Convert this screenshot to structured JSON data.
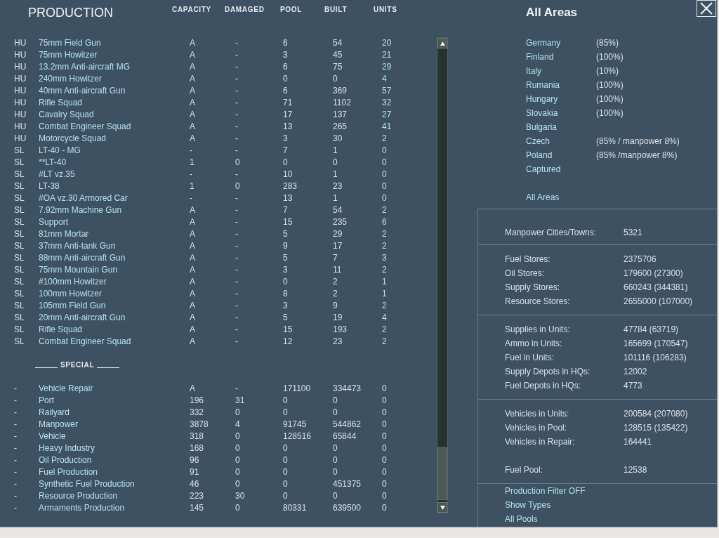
{
  "production": {
    "title": "PRODUCTION",
    "columns": [
      "CAPACITY",
      "DAMAGED",
      "POOL",
      "BUILT",
      "UNITS"
    ],
    "rows": [
      {
        "nation": "HU",
        "name": "75mm Field Gun",
        "capacity": "A",
        "damaged": "-",
        "pool": "6",
        "built": "54",
        "units": "20"
      },
      {
        "nation": "HU",
        "name": "75mm Howitzer",
        "capacity": "A",
        "damaged": "-",
        "pool": "3",
        "built": "45",
        "units": "21"
      },
      {
        "nation": "HU",
        "name": "13.2mm Anti-aircraft MG",
        "capacity": "A",
        "damaged": "-",
        "pool": "6",
        "built": "75",
        "units": "29"
      },
      {
        "nation": "HU",
        "name": "240mm Howitzer",
        "capacity": "A",
        "damaged": "-",
        "pool": "0",
        "built": "0",
        "units": "4"
      },
      {
        "nation": "HU",
        "name": "40mm Anti-aircraft Gun",
        "capacity": "A",
        "damaged": "-",
        "pool": "6",
        "built": "369",
        "units": "57"
      },
      {
        "nation": "HU",
        "name": "Rifle Squad",
        "capacity": "A",
        "damaged": "-",
        "pool": "71",
        "built": "1102",
        "units": "32"
      },
      {
        "nation": "HU",
        "name": "Cavalry Squad",
        "capacity": "A",
        "damaged": "-",
        "pool": "17",
        "built": "137",
        "units": "27"
      },
      {
        "nation": "HU",
        "name": "Combat Engineer Squad",
        "capacity": "A",
        "damaged": "-",
        "pool": "13",
        "built": "265",
        "units": "41"
      },
      {
        "nation": "HU",
        "name": "Motorcycle Squad",
        "capacity": "A",
        "damaged": "-",
        "pool": "3",
        "built": "30",
        "units": "2"
      },
      {
        "nation": "SL",
        "name": "LT-40 - MG",
        "capacity": "-",
        "damaged": "-",
        "pool": "7",
        "built": "1",
        "units": "0"
      },
      {
        "nation": "SL",
        "name": "**LT-40",
        "capacity": "1",
        "damaged": "0",
        "pool": "0",
        "built": "0",
        "units": "0"
      },
      {
        "nation": "SL",
        "name": "#LT vz.35",
        "capacity": "-",
        "damaged": "-",
        "pool": "10",
        "built": "1",
        "units": "0"
      },
      {
        "nation": "SL",
        "name": "LT-38",
        "capacity": "1",
        "damaged": "0",
        "pool": "283",
        "built": "23",
        "units": "0"
      },
      {
        "nation": "SL",
        "name": "#OA vz.30 Armored Car",
        "capacity": "-",
        "damaged": "-",
        "pool": "13",
        "built": "1",
        "units": "0"
      },
      {
        "nation": "SL",
        "name": "7.92mm Machine Gun",
        "capacity": "A",
        "damaged": "-",
        "pool": "7",
        "built": "54",
        "units": "2"
      },
      {
        "nation": "SL",
        "name": "Support",
        "capacity": "A",
        "damaged": "-",
        "pool": "15",
        "built": "235",
        "units": "6"
      },
      {
        "nation": "SL",
        "name": "81mm Mortar",
        "capacity": "A",
        "damaged": "-",
        "pool": "5",
        "built": "29",
        "units": "2"
      },
      {
        "nation": "SL",
        "name": "37mm Anti-tank Gun",
        "capacity": "A",
        "damaged": "-",
        "pool": "9",
        "built": "17",
        "units": "2"
      },
      {
        "nation": "SL",
        "name": "88mm Anti-aircraft Gun",
        "capacity": "A",
        "damaged": "-",
        "pool": "5",
        "built": "7",
        "units": "3"
      },
      {
        "nation": "SL",
        "name": "75mm Mountain Gun",
        "capacity": "A",
        "damaged": "-",
        "pool": "3",
        "built": "11",
        "units": "2"
      },
      {
        "nation": "SL",
        "name": "#100mm Howitzer",
        "capacity": "A",
        "damaged": "-",
        "pool": "0",
        "built": "2",
        "units": "1"
      },
      {
        "nation": "SL",
        "name": "100mm Howitzer",
        "capacity": "A",
        "damaged": "-",
        "pool": "8",
        "built": "2",
        "units": "1"
      },
      {
        "nation": "SL",
        "name": "105mm Field Gun",
        "capacity": "A",
        "damaged": "-",
        "pool": "3",
        "built": "9",
        "units": "2"
      },
      {
        "nation": "SL",
        "name": "20mm Anti-aircraft Gun",
        "capacity": "A",
        "damaged": "-",
        "pool": "5",
        "built": "19",
        "units": "4"
      },
      {
        "nation": "SL",
        "name": "Rifle Squad",
        "capacity": "A",
        "damaged": "-",
        "pool": "15",
        "built": "193",
        "units": "2"
      },
      {
        "nation": "SL",
        "name": "Combat Engineer Squad",
        "capacity": "A",
        "damaged": "-",
        "pool": "12",
        "built": "23",
        "units": "2"
      }
    ],
    "special": {
      "heading": "SPECIAL",
      "rows": [
        {
          "nation": "-",
          "name": "Vehicle Repair",
          "capacity": "A",
          "damaged": "-",
          "pool": "171100",
          "built": "334473",
          "units": "0"
        },
        {
          "nation": "-",
          "name": "Port",
          "capacity": "196",
          "damaged": "31",
          "pool": "0",
          "built": "0",
          "units": "0"
        },
        {
          "nation": "-",
          "name": "Railyard",
          "capacity": "332",
          "damaged": "0",
          "pool": "0",
          "built": "0",
          "units": "0"
        },
        {
          "nation": "-",
          "name": "Manpower",
          "capacity": "3878",
          "damaged": "4",
          "pool": "91745",
          "built": "544862",
          "units": "0"
        },
        {
          "nation": "-",
          "name": "Vehicle",
          "capacity": "318",
          "damaged": "0",
          "pool": "128516",
          "built": "65844",
          "units": "0"
        },
        {
          "nation": "-",
          "name": "Heavy Industry",
          "capacity": "168",
          "damaged": "0",
          "pool": "0",
          "built": "0",
          "units": "0"
        },
        {
          "nation": "-",
          "name": "Oil Production",
          "capacity": "96",
          "damaged": "0",
          "pool": "0",
          "built": "0",
          "units": "0"
        },
        {
          "nation": "-",
          "name": "Fuel Production",
          "capacity": "91",
          "damaged": "0",
          "pool": "0",
          "built": "0",
          "units": "0"
        },
        {
          "nation": "-",
          "name": "Synthetic Fuel Production",
          "capacity": "46",
          "damaged": "0",
          "pool": "0",
          "built": "451375",
          "units": "0"
        },
        {
          "nation": "-",
          "name": "Resource Production",
          "capacity": "223",
          "damaged": "30",
          "pool": "0",
          "built": "0",
          "units": "0"
        },
        {
          "nation": "-",
          "name": "Armaments Production",
          "capacity": "145",
          "damaged": "0",
          "pool": "80331",
          "built": "639500",
          "units": "0"
        }
      ]
    }
  },
  "areas_panel": {
    "title": "All Areas",
    "areas": [
      {
        "name": "Germany",
        "value": "(85%)"
      },
      {
        "name": "Finland",
        "value": "(100%)"
      },
      {
        "name": "Italy",
        "value": "(10%)"
      },
      {
        "name": "Rumania",
        "value": "(100%)"
      },
      {
        "name": "Hungary",
        "value": "(100%)"
      },
      {
        "name": "Slovakia",
        "value": "(100%)"
      },
      {
        "name": "Bulgaria"
      },
      {
        "name": "Czech",
        "value": "(85% / manpower 8%)"
      },
      {
        "name": "Poland",
        "value": "(85% /manpower 8%)"
      },
      {
        "name": "Captured"
      }
    ],
    "all_areas_link": "All Areas"
  },
  "stat_sections": [
    {
      "groups": [
        [
          {
            "label": "Manpower Cities/Towns:",
            "value": "5321"
          }
        ]
      ]
    },
    {
      "groups": [
        [
          {
            "label": "Fuel Stores:",
            "value": "2375706"
          },
          {
            "label": "Oil Stores:",
            "value": "179600 (27300)"
          },
          {
            "label": "Supply Stores:",
            "value": "660243 (344381)"
          },
          {
            "label": "Resource Stores:",
            "value": "2655000 (107000)"
          }
        ]
      ]
    },
    {
      "groups": [
        [
          {
            "label": "Supplies in Units:",
            "value": "47784 (63719)"
          },
          {
            "label": "Ammo in Units:",
            "value": "165699 (170547)"
          },
          {
            "label": "Fuel in Units:",
            "value": "101116 (106283)"
          },
          {
            "label": "Supply Depots in HQs:",
            "value": "12002"
          },
          {
            "label": "Fuel Depots in HQs:",
            "value": "4773"
          }
        ]
      ]
    },
    {
      "groups": [
        [
          {
            "label": "Vehicles in Units:",
            "value": "200584 (207080)"
          },
          {
            "label": "Vehicles in Pool:",
            "value": "128515 (135422)"
          },
          {
            "label": "Vehicles in Repair:",
            "value": "164441"
          }
        ],
        [
          {
            "label": "Fuel Pool:",
            "value": "12538"
          }
        ]
      ]
    }
  ],
  "links": [
    "Production Filter OFF",
    "Show Types",
    "All Pools"
  ]
}
